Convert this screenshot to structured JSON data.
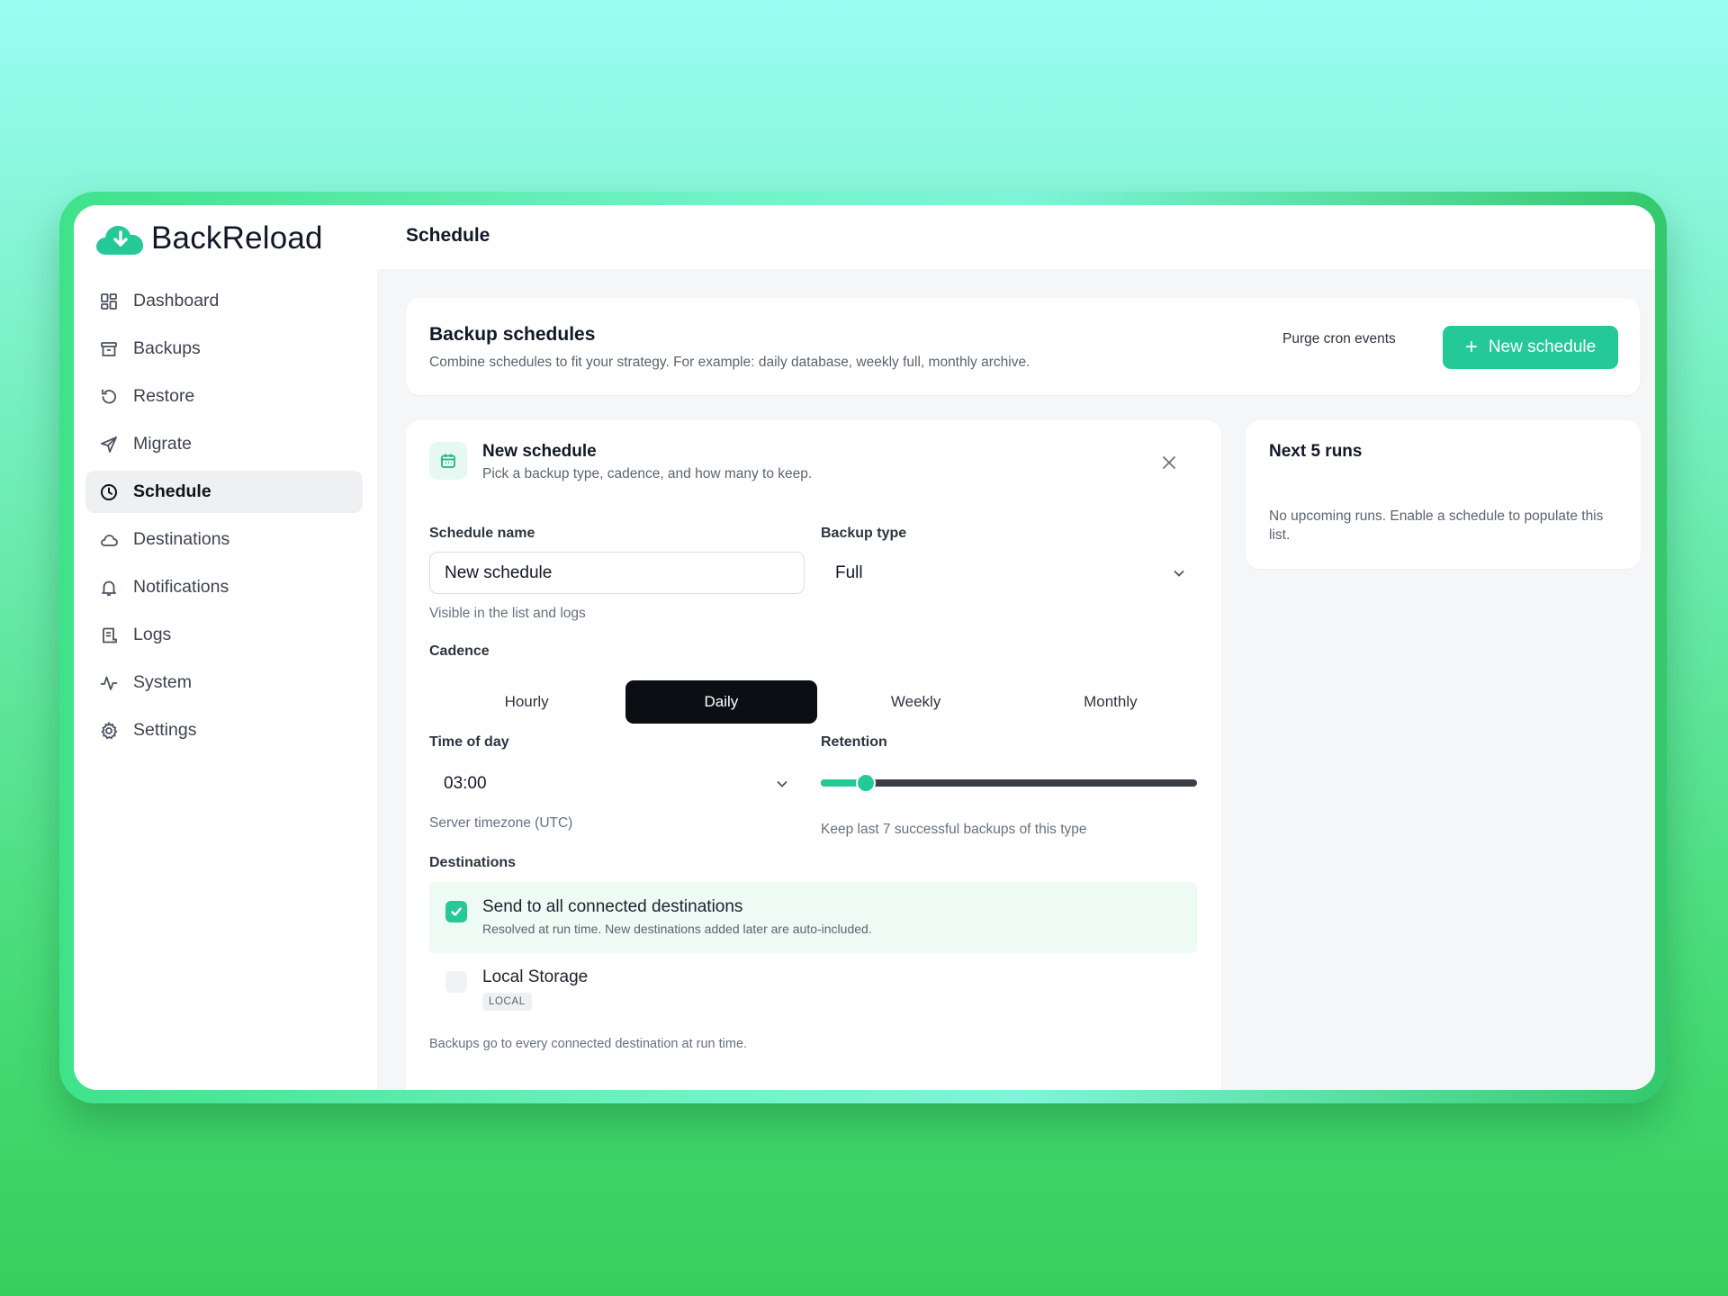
{
  "app": {
    "name": "BackReload",
    "accent_color": "#24c997"
  },
  "topbar": {
    "title": "Schedule"
  },
  "sidebar": {
    "items": [
      {
        "label": "Dashboard",
        "icon": "dashboard-icon"
      },
      {
        "label": "Backups",
        "icon": "archive-icon"
      },
      {
        "label": "Restore",
        "icon": "restore-icon"
      },
      {
        "label": "Migrate",
        "icon": "send-icon"
      },
      {
        "label": "Schedule",
        "icon": "clock-icon",
        "active": true
      },
      {
        "label": "Destinations",
        "icon": "cloud-icon"
      },
      {
        "label": "Notifications",
        "icon": "bell-icon"
      },
      {
        "label": "Logs",
        "icon": "scroll-icon"
      },
      {
        "label": "System",
        "icon": "activity-icon"
      },
      {
        "label": "Settings",
        "icon": "gear-icon"
      }
    ]
  },
  "header_card": {
    "title": "Backup schedules",
    "subtitle": "Combine schedules to fit your strategy. For example: daily database, weekly full, monthly archive.",
    "purge_label": "Purge cron events",
    "new_label": "New schedule"
  },
  "form": {
    "title": "New schedule",
    "subtitle": "Pick a backup type, cadence, and how many to keep.",
    "name_label": "Schedule name",
    "name_value": "New schedule",
    "name_hint": "Visible in the list and logs",
    "type_label": "Backup type",
    "type_value": "Full",
    "cadence_label": "Cadence",
    "cadence_options": [
      "Hourly",
      "Daily",
      "Weekly",
      "Monthly"
    ],
    "cadence_selected": "Daily",
    "time_label": "Time of day",
    "time_value": "03:00",
    "time_hint": "Server timezone (UTC)",
    "retention_label": "Retention",
    "retention_fraction": 0.12,
    "retention_hint": "Keep last 7 successful backups of this type",
    "destinations_label": "Destinations",
    "all_dest_title": "Send to all connected destinations",
    "all_dest_sub": "Resolved at run time. New destinations added later are auto-included.",
    "all_dest_checked": true,
    "local_title": "Local Storage",
    "local_badge": "LOCAL",
    "local_checked": false,
    "footer_hint": "Backups go to every connected destination at run time."
  },
  "runs": {
    "title": "Next 5 runs",
    "empty": "No upcoming runs. Enable a schedule to populate this list."
  }
}
